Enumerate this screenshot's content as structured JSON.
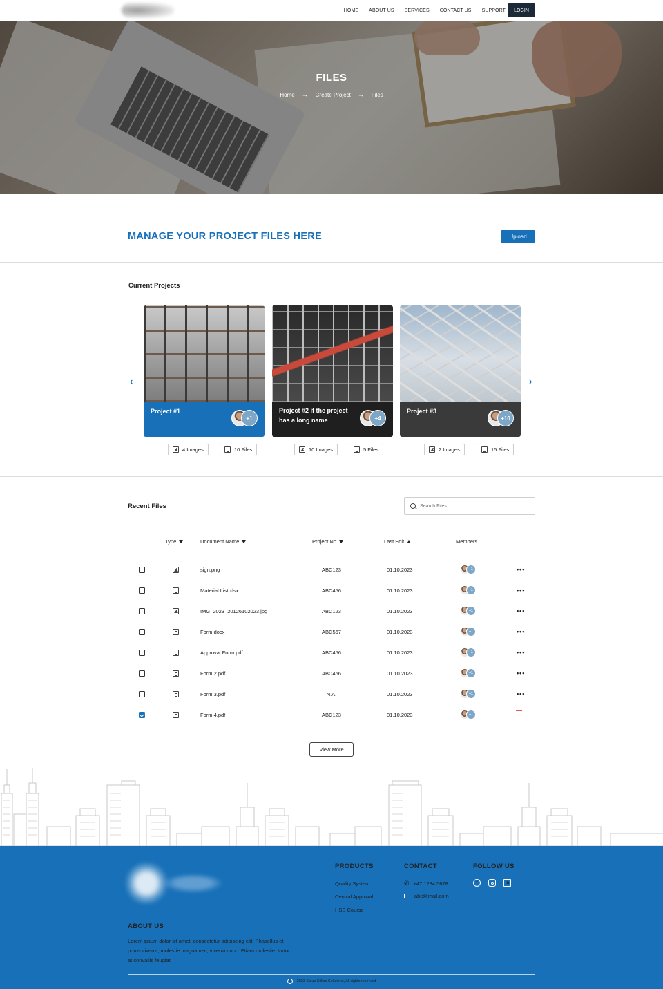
{
  "nav": {
    "links": [
      "HOME",
      "ABOUT US",
      "SERVICES",
      "CONTACT US",
      "SUPPORT"
    ],
    "login_label": "LOGIN"
  },
  "hero": {
    "title": "FILES",
    "breadcrumb": [
      "Home",
      "Create Project",
      "Files"
    ]
  },
  "manage": {
    "title": "MANAGE YOUR PROJECT FILES HERE",
    "upload_label": "Upload"
  },
  "projects": {
    "section_title": "Current Projects",
    "items": [
      {
        "name": "Project #1",
        "extra_members": "+1",
        "images": "4 Images",
        "files": "10 Files",
        "bar_color": "#1770b8"
      },
      {
        "name": "Project #2 if the project has a long name",
        "extra_members": "+4",
        "images": "10 Images",
        "files": "5 Files",
        "bar_color": "#1f1f1f"
      },
      {
        "name": "Project #3",
        "extra_members": "+10",
        "images": "2 Images",
        "files": "15 Files",
        "bar_color": "#3a3a3a"
      }
    ]
  },
  "recent": {
    "section_title": "Recent Files",
    "search_placeholder": "Search Files",
    "columns": {
      "type": "Type",
      "name": "Document Name",
      "project": "Project No",
      "edit": "Last Edit",
      "members": "Members"
    },
    "rows": [
      {
        "checked": false,
        "kind": "image",
        "name": "sign.png",
        "project": "ABC123",
        "edit": "01.10.2023",
        "extra": "+1",
        "action": "more"
      },
      {
        "checked": false,
        "kind": "doc",
        "name": "Material List.xlsx",
        "project": "ABC456",
        "edit": "01.10.2023",
        "extra": "+1",
        "action": "more"
      },
      {
        "checked": false,
        "kind": "image",
        "name": "IMG_2023_20126102023.jpg",
        "project": "ABC123",
        "edit": "01.10.2023",
        "extra": "+1",
        "action": "more"
      },
      {
        "checked": false,
        "kind": "doc",
        "name": "Form.docx",
        "project": "ABC567",
        "edit": "01.10.2023",
        "extra": "+1",
        "action": "more"
      },
      {
        "checked": false,
        "kind": "doc",
        "name": "Approval Form.pdf",
        "project": "ABC456",
        "edit": "01.10.2023",
        "extra": "+1",
        "action": "more"
      },
      {
        "checked": false,
        "kind": "doc",
        "name": "Form 2.pdf",
        "project": "ABC456",
        "edit": "01.10.2023",
        "extra": "+1",
        "action": "more"
      },
      {
        "checked": false,
        "kind": "doc",
        "name": "Form 3.pdf",
        "project": "N.A.",
        "edit": "01.10.2023",
        "extra": "+1",
        "action": "more"
      },
      {
        "checked": true,
        "kind": "doc",
        "name": "Form 4.pdf",
        "project": "ABC123",
        "edit": "01.10.2023",
        "extra": "+1",
        "action": "delete"
      }
    ],
    "view_more_label": "View More"
  },
  "footer": {
    "products_title": "PRODUCTS",
    "products": [
      "Quality System",
      "Central Approval",
      "HSE Course"
    ],
    "contact_title": "CONTACT",
    "phone": "+47 1234 5678",
    "email": "abc@mail.com",
    "follow_title": "FOLLOW US",
    "about_title": "ABOUT US",
    "about_text": "Lorem ipsum dolor sit amet, consectetur adipiscing elit. Phasellus et purus viverra, molestie magna nec, viverra nunc. Etiam molestie, tortor at convallis feugiat",
    "copyright": "2023 Salus Stillas Solutions, All rights reserved"
  },
  "colors": {
    "accent": "#1770b8",
    "dark": "#1c2a38",
    "danger": "#e05a5a"
  }
}
